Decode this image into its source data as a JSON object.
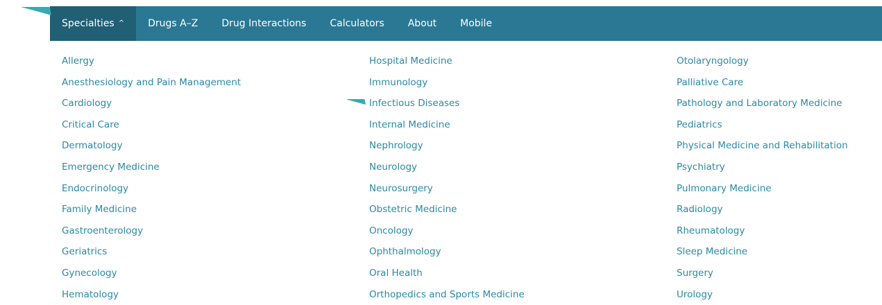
{
  "nav": {
    "items": [
      {
        "label": "Specialties",
        "name": "nav-specialties",
        "active": true,
        "caret": "^"
      },
      {
        "label": "Drugs A–Z",
        "name": "nav-drugs-a-z"
      },
      {
        "label": "Drug Interactions",
        "name": "nav-drug-interactions"
      },
      {
        "label": "Calculators",
        "name": "nav-calculators"
      },
      {
        "label": "About",
        "name": "nav-about"
      },
      {
        "label": "Mobile",
        "name": "nav-mobile"
      }
    ]
  },
  "specialties": {
    "columns": [
      [
        "Allergy",
        "Anesthesiology and Pain Management",
        "Cardiology",
        "Critical Care",
        "Dermatology",
        "Emergency Medicine",
        "Endocrinology",
        "Family Medicine",
        "Gastroenterology",
        "Geriatrics",
        "Gynecology",
        "Hematology"
      ],
      [
        "Hospital Medicine",
        "Immunology",
        "Infectious Diseases",
        "Internal Medicine",
        "Nephrology",
        "Neurology",
        "Neurosurgery",
        "Obstetric Medicine",
        "Oncology",
        "Ophthalmology",
        "Oral Health",
        "Orthopedics and Sports Medicine"
      ],
      [
        "Otolaryngology",
        "Palliative Care",
        "Pathology and Laboratory Medicine",
        "Pediatrics",
        "Physical Medicine and Rehabilitation",
        "Psychiatry",
        "Pulmonary Medicine",
        "Radiology",
        "Rheumatology",
        "Sleep Medicine",
        "Surgery",
        "Urology"
      ]
    ]
  },
  "colors": {
    "navbar": "#2a7893",
    "navbar_active": "#215f74",
    "link": "#2a89a4",
    "arrow": "#38aab4"
  },
  "annotations": {
    "arrow_icon": "arrow-pointer-icon"
  }
}
